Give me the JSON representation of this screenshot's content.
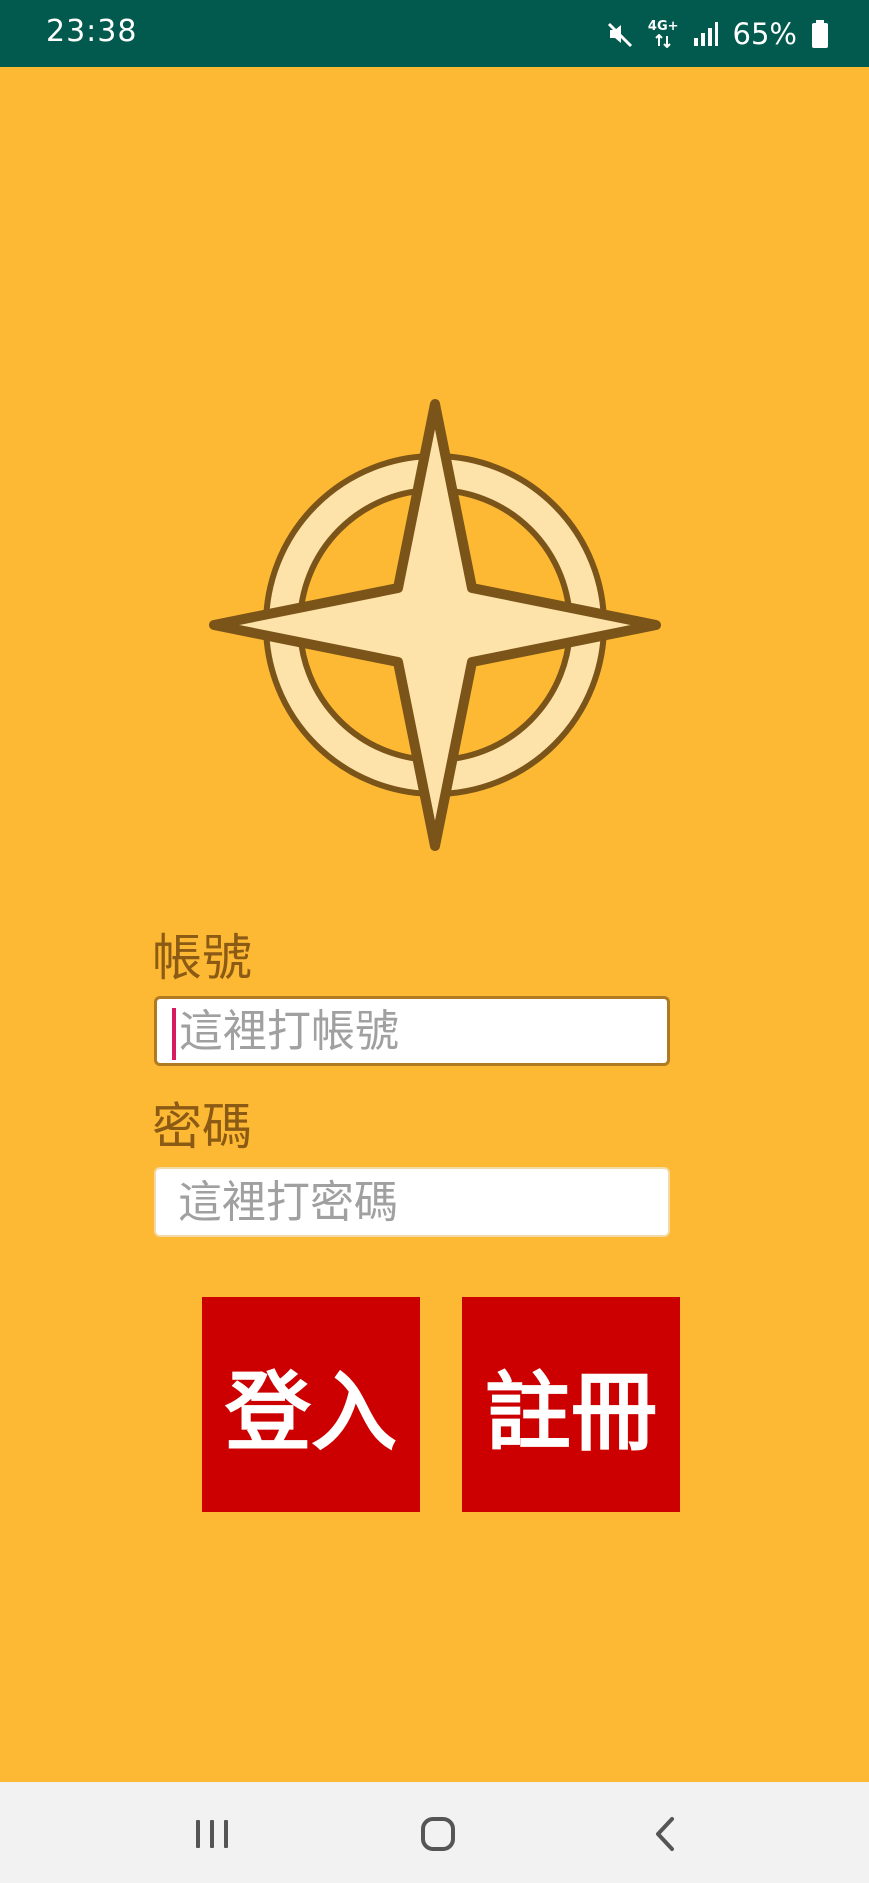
{
  "status_bar": {
    "time": "23:38",
    "network": "4G+",
    "battery": "65%",
    "icons": [
      "mute-icon",
      "network-4g-icon",
      "signal-icon",
      "battery-icon"
    ]
  },
  "logo": {
    "icon": "compass-star-icon"
  },
  "form": {
    "account_label": "帳號",
    "account_placeholder": "這裡打帳號",
    "password_label": "密碼",
    "password_placeholder": "這裡打密碼"
  },
  "buttons": {
    "login": "登入",
    "register": "註冊"
  },
  "navigation": {
    "icons": [
      "recents-icon",
      "home-icon",
      "back-icon"
    ]
  },
  "colors": {
    "background": "#FDB933",
    "status_bar": "#025A4E",
    "button": "#CC0000",
    "label_text": "#8B5A14"
  }
}
